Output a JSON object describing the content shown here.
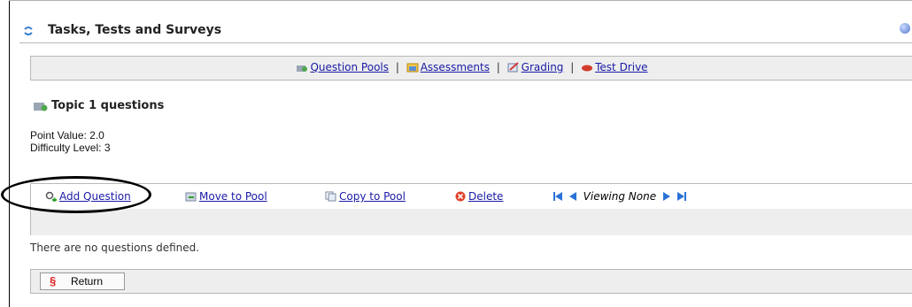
{
  "header": {
    "title": "Tasks, Tests and Surveys"
  },
  "nav": {
    "items": [
      {
        "label": "Question Pools",
        "icon": "question-pools-icon"
      },
      {
        "label": "Assessments",
        "icon": "assessments-icon"
      },
      {
        "label": "Grading",
        "icon": "grading-icon"
      },
      {
        "label": "Test Drive",
        "icon": "test-drive-icon"
      }
    ],
    "separator": "|"
  },
  "pool": {
    "title": "Topic 1 questions",
    "point_value": "Point Value: 2.0",
    "difficulty": "Difficulty Level: 3"
  },
  "toolbar": {
    "add": "Add Question",
    "move": "Move to Pool",
    "copy": "Copy to Pool",
    "delete": "Delete",
    "viewing": "Viewing None"
  },
  "list": {
    "empty_message": "There are no questions defined."
  },
  "footer": {
    "return_label": "Return"
  },
  "colors": {
    "link": "#1a1aa6",
    "bar_bg": "#eeeeee",
    "border": "#b8b8b8"
  }
}
